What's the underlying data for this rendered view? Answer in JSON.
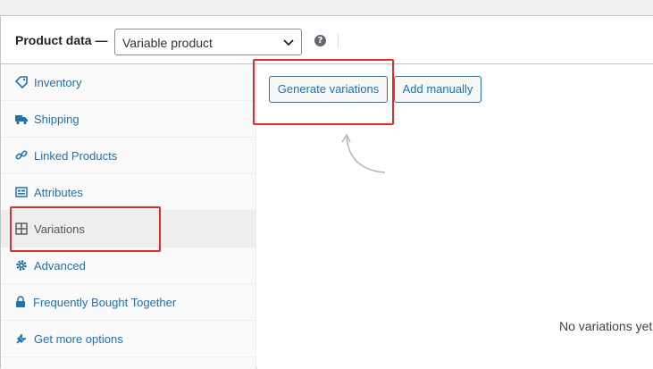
{
  "header": {
    "title": "Product data —",
    "product_type": "Variable product",
    "help": "?"
  },
  "tabs": [
    {
      "label": "Inventory",
      "icon": "tag-icon"
    },
    {
      "label": "Shipping",
      "icon": "truck-icon"
    },
    {
      "label": "Linked Products",
      "icon": "link-icon"
    },
    {
      "label": "Attributes",
      "icon": "list-view-icon"
    },
    {
      "label": "Variations",
      "icon": "grid-icon",
      "active": true
    },
    {
      "label": "Advanced",
      "icon": "gear-icon"
    },
    {
      "label": "Frequently Bought Together",
      "icon": "lock-icon"
    },
    {
      "label": "Get more options",
      "icon": "plugin-icon"
    }
  ],
  "content": {
    "generate_label": "Generate variations",
    "add_label": "Add manually",
    "empty_message": "No variations yet"
  },
  "colors": {
    "accent": "#2271b1",
    "highlight": "#e62b2b"
  }
}
